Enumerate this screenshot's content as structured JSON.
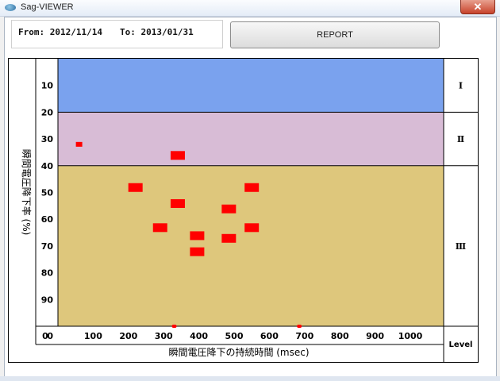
{
  "window": {
    "title": "Sag-VIEWER",
    "close_symbol": "✕"
  },
  "header": {
    "from_label": "From: 2012/11/14",
    "to_label": "To: 2013/01/31",
    "report_label": "REPORT"
  },
  "chart_data": {
    "type": "scatter",
    "xlabel": "瞬間電圧降下の持続時間 (msec)",
    "ylabel": "瞬間電圧降下率 (%)",
    "xlim": [
      0,
      1000
    ],
    "ylim": [
      0,
      100
    ],
    "x_ticks": [
      "0",
      "100",
      "200",
      "300",
      "400",
      "500",
      "600",
      "700",
      "800",
      "900",
      "1000"
    ],
    "y_ticks": [
      "10",
      "20",
      "30",
      "40",
      "50",
      "60",
      "70",
      "80",
      "90",
      "0"
    ],
    "y_inverted": true,
    "bands": [
      {
        "level": "Ⅰ",
        "from": 0,
        "to": 20,
        "color": "#7aa2ee"
      },
      {
        "level": "Ⅱ",
        "from": 20,
        "to": 40,
        "color": "#d8bcd6"
      },
      {
        "level": "Ⅲ",
        "from": 40,
        "to": 100,
        "color": "#dec77c"
      }
    ],
    "level_header": "Level",
    "point_color": "#ff0000",
    "points": [
      {
        "x": 60,
        "y": 32,
        "marker": "small"
      },
      {
        "x": 340,
        "y": 36,
        "marker": "large"
      },
      {
        "x": 220,
        "y": 48,
        "marker": "large"
      },
      {
        "x": 340,
        "y": 54,
        "marker": "large"
      },
      {
        "x": 290,
        "y": 63,
        "marker": "large"
      },
      {
        "x": 395,
        "y": 66,
        "marker": "large"
      },
      {
        "x": 395,
        "y": 72,
        "marker": "large"
      },
      {
        "x": 485,
        "y": 56,
        "marker": "large"
      },
      {
        "x": 485,
        "y": 67,
        "marker": "large"
      },
      {
        "x": 550,
        "y": 48,
        "marker": "large"
      },
      {
        "x": 550,
        "y": 63,
        "marker": "large"
      },
      {
        "x": 330,
        "y": 100,
        "marker": "dot"
      },
      {
        "x": 685,
        "y": 100,
        "marker": "dot"
      }
    ]
  }
}
